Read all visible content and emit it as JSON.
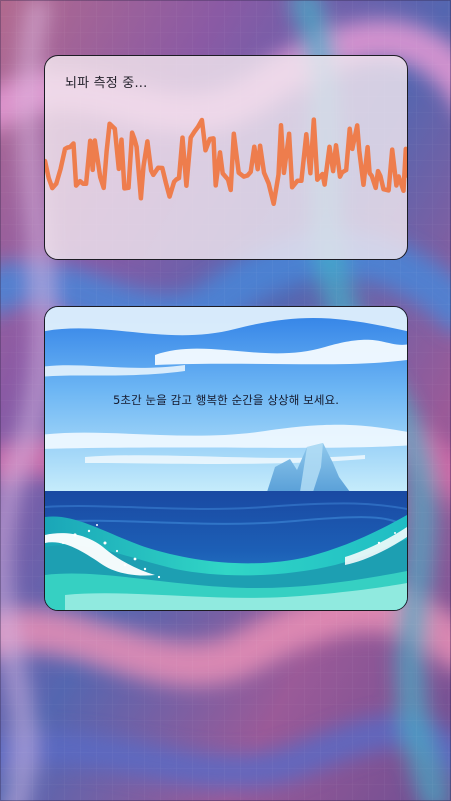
{
  "measuring": {
    "status_text": "뇌파 측정 중...",
    "wave_color": "#ee7d4d"
  },
  "prompt": {
    "instruction_text": "5초간 눈을 감고 행복한 순간을 상상해 보세요."
  },
  "colors": {
    "background_primary": "#8a5a9e",
    "background_accent": "#3a5aa6",
    "card_border": "#1c1c24",
    "sea_dark": "#173f92",
    "sea_turquoise": "#2fd2c4"
  },
  "icons": {
    "scene": "ocean-iceberg-illustration"
  }
}
